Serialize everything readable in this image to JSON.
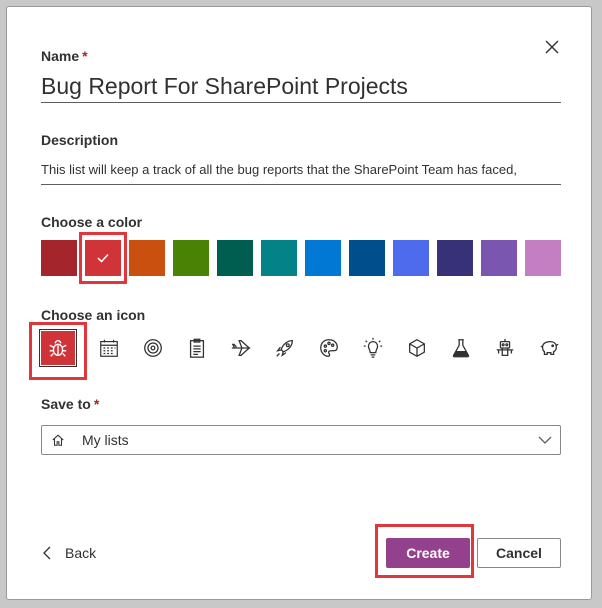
{
  "form": {
    "name_label": "Name",
    "required_mark": "*",
    "name_value": "Bug Report For SharePoint Projects",
    "description_label": "Description",
    "description_value": "This list will keep a track of all the bug reports that the SharePoint Team has faced,",
    "color_label": "Choose a color",
    "icon_label": "Choose an icon",
    "save_to_label": "Save to",
    "save_to_value": "My lists"
  },
  "colors": {
    "selected_index": 1,
    "swatches": [
      "#a4262c",
      "#d13438",
      "#ca5010",
      "#498205",
      "#005e50",
      "#038387",
      "#0078d4",
      "#004e8c",
      "#4f6bed",
      "#373277",
      "#8764b8",
      "#c239b3"
    ],
    "swatches_display": [
      "#a4262c",
      "#d13438",
      "#ca5010",
      "#498205",
      "#005e50",
      "#038387",
      "#0078d4",
      "#004e8c",
      "#4f6bed",
      "#373277",
      "#7a56b1",
      "#c37fc1"
    ],
    "highlight": "#e0373d"
  },
  "icons": {
    "selected_index": 0,
    "items": [
      "bug-icon",
      "calendar-icon",
      "target-icon",
      "clipboard-icon",
      "airplane-icon",
      "rocket-icon",
      "palette-icon",
      "lightbulb-icon",
      "cube-icon",
      "beaker-icon",
      "robot-icon",
      "piggy-bank-icon"
    ]
  },
  "footer": {
    "back_label": "Back",
    "create_label": "Create",
    "cancel_label": "Cancel"
  },
  "theme": {
    "accent": "#94418d",
    "text": "#323130",
    "border": "#8a8886"
  }
}
